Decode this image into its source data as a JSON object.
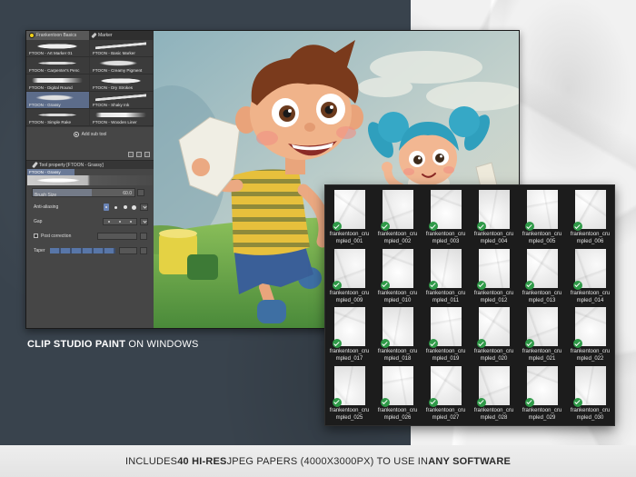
{
  "caption": {
    "bold": "CLIP STUDIO PAINT",
    "rest": " ON WINDOWS"
  },
  "footer": {
    "part1": "INCLUDES ",
    "part2": "40 HI-RES",
    "part3": " JPEG PAPERS (4000X3000PX) TO USE IN ",
    "part4": "ANY SOFTWARE"
  },
  "csp": {
    "tabs": [
      {
        "label": "Frankentoon Basics",
        "icon": "brush-set-icon",
        "active": true
      },
      {
        "label": "Marker",
        "icon": "marker-icon",
        "active": false
      }
    ],
    "brushes": [
      {
        "label": "FTOON - Art Marker 01"
      },
      {
        "label": "FTOON - Basic Marker"
      },
      {
        "label": "FTOON - Carpenter's Penc"
      },
      {
        "label": "FTOON - Creamy Pigment"
      },
      {
        "label": "FTOON - Digital Round"
      },
      {
        "label": "FTOON - Dry Strokes"
      },
      {
        "label": "FTOON - Grassy",
        "selected": true
      },
      {
        "label": "FTOON - Shaky Ink"
      },
      {
        "label": "FTOON - Simple Rake"
      },
      {
        "label": "FTOON - Wooden Liner"
      }
    ],
    "add_sub_tool": "Add sub tool",
    "tool_property": {
      "title": "Tool property [FTOON - Grassy]",
      "icon": "wrench-icon",
      "preset": "FTOON - Grassy",
      "brush_size": {
        "label": "Brush Size",
        "value": "60.0"
      },
      "anti_aliasing": {
        "label": "Anti-aliasing",
        "selected_index": 0
      },
      "gap": {
        "label": "Gap"
      },
      "post_correction": {
        "label": "Post correction",
        "checked": false
      },
      "taper": {
        "label": "Taper"
      }
    }
  },
  "browser": {
    "files": [
      {
        "line1": "frankentoon_cru",
        "line2": "mpled_001"
      },
      {
        "line1": "frankentoon_cru",
        "line2": "mpled_002"
      },
      {
        "line1": "frankentoon_cru",
        "line2": "mpled_003"
      },
      {
        "line1": "frankentoon_cru",
        "line2": "mpled_004"
      },
      {
        "line1": "frankentoon_cru",
        "line2": "mpled_005"
      },
      {
        "line1": "frankentoon_cru",
        "line2": "mpled_006"
      },
      {
        "line1": "frankentoon_cru",
        "line2": "mpled_009"
      },
      {
        "line1": "frankentoon_cru",
        "line2": "mpled_010"
      },
      {
        "line1": "frankentoon_cru",
        "line2": "mpled_011"
      },
      {
        "line1": "frankentoon_cru",
        "line2": "mpled_012"
      },
      {
        "line1": "frankentoon_cru",
        "line2": "mpled_013"
      },
      {
        "line1": "frankentoon_cru",
        "line2": "mpled_014"
      },
      {
        "line1": "frankentoon_cru",
        "line2": "mpled_017"
      },
      {
        "line1": "frankentoon_cru",
        "line2": "mpled_018"
      },
      {
        "line1": "frankentoon_cru",
        "line2": "mpled_019"
      },
      {
        "line1": "frankentoon_cru",
        "line2": "mpled_020"
      },
      {
        "line1": "frankentoon_cru",
        "line2": "mpled_021"
      },
      {
        "line1": "frankentoon_cru",
        "line2": "mpled_022"
      },
      {
        "line1": "frankentoon_cru",
        "line2": "mpled_025"
      },
      {
        "line1": "frankentoon_cru",
        "line2": "mpled_026"
      },
      {
        "line1": "frankentoon_cru",
        "line2": "mpled_027"
      },
      {
        "line1": "frankentoon_cru",
        "line2": "mpled_028"
      },
      {
        "line1": "frankentoon_cru",
        "line2": "mpled_029"
      },
      {
        "line1": "frankentoon_cru",
        "line2": "mpled_030"
      }
    ],
    "check_icon": "check-circle-icon"
  },
  "colors": {
    "backdrop_dark": "#39434d",
    "paper": "#f1f1f1",
    "selected_brush": "#5c6c8a",
    "check_green": "#2f9a48",
    "browser_bg": "#1c1c1c"
  }
}
